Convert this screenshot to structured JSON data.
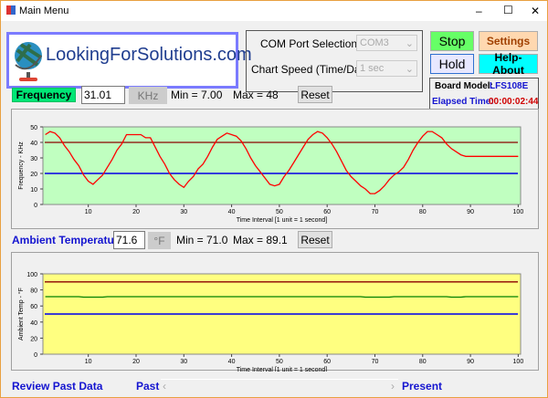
{
  "window": {
    "title": "Main Menu",
    "minimize": "–",
    "maximize": "☐",
    "close": "✕"
  },
  "logo": {
    "text": "LookingForSolutions.com"
  },
  "settings_panel": {
    "com_label": "COM Port Selection",
    "com_value": "COM3",
    "speed_label": "Chart Speed (Time/Data)",
    "speed_value": "1 sec"
  },
  "buttons": {
    "stop": "Stop",
    "settings": "Settings",
    "hold": "Hold",
    "help": "Help-About",
    "reset": "Reset"
  },
  "board": {
    "model_label": "Board Model:",
    "model_value": "LFS108E",
    "elapsed_label": "Elapsed Time:",
    "elapsed_value": "00:00:02:44"
  },
  "frequency": {
    "label": "Frequency",
    "value": "31.01",
    "unit": "KHz",
    "min": "Min = 7.00",
    "max": "Max = 48"
  },
  "temperature": {
    "label": "Ambient Temperature",
    "value": "71.6",
    "unit": "°F",
    "min": "Min = 71.0",
    "max": "Max = 89.1"
  },
  "footer": {
    "review": "Review Past Data",
    "past": "Past",
    "present": "Present"
  },
  "colors": {
    "freq_bg": "#c0ffc0",
    "temp_bg": "#ffff80",
    "series_freq": "#ff0000",
    "series_temp": "#008000",
    "upper": "#8b0000",
    "lower": "#2020e0"
  },
  "chart_data": [
    {
      "type": "line",
      "title": "",
      "xlabel": "Time Interval [1 unit = 1 second]",
      "ylabel": "Frequency - KHz",
      "xlim": [
        1,
        100
      ],
      "ylim": [
        0,
        50
      ],
      "xticks": [
        10,
        20,
        30,
        40,
        50,
        60,
        70,
        80,
        90,
        100
      ],
      "yticks": [
        0,
        10,
        20,
        30,
        40,
        50
      ],
      "series": [
        {
          "name": "Frequency",
          "values": [
            45,
            47,
            46,
            43,
            38,
            34,
            29,
            25,
            19,
            15,
            13,
            16,
            19,
            24,
            29,
            35,
            39,
            45,
            45,
            45,
            45,
            43,
            43,
            37,
            31,
            26,
            20,
            16,
            13,
            11,
            15,
            18,
            23,
            26,
            31,
            37,
            42,
            44,
            46,
            45,
            44,
            41,
            36,
            30,
            25,
            21,
            17,
            13,
            12,
            13,
            18,
            22,
            27,
            32,
            37,
            42,
            45,
            47,
            46,
            43,
            39,
            34,
            28,
            22,
            18,
            15,
            12,
            10,
            7,
            7,
            9,
            12,
            16,
            19,
            21,
            24,
            29,
            35,
            40,
            44,
            47,
            47,
            45,
            43,
            39,
            36,
            34,
            32,
            31,
            31,
            31,
            31,
            31,
            31,
            31,
            31,
            31,
            31,
            31,
            31
          ]
        }
      ],
      "limits": {
        "upper": 40,
        "lower": 20
      }
    },
    {
      "type": "line",
      "title": "",
      "xlabel": "Time Interval [1 unit = 1 second]",
      "ylabel": "Ambient Temp - °F",
      "xlim": [
        1,
        100
      ],
      "ylim": [
        0,
        100
      ],
      "xticks": [
        10,
        20,
        30,
        40,
        50,
        60,
        70,
        80,
        90,
        100
      ],
      "yticks": [
        0,
        20,
        40,
        60,
        80,
        100
      ],
      "series": [
        {
          "name": "Ambient Temperature",
          "values": [
            71.6,
            71.6,
            71.6,
            71.6,
            71.6,
            71.6,
            71.6,
            71.6,
            71.0,
            71.0,
            71.0,
            71.0,
            71.0,
            71.6,
            71.6,
            71.6,
            71.6,
            71.6,
            71.6,
            71.6,
            71.6,
            71.6,
            71.6,
            71.6,
            71.6,
            71.6,
            71.6,
            71.6,
            71.6,
            71.6,
            71.6,
            71.6,
            71.6,
            71.6,
            71.6,
            71.6,
            71.6,
            71.6,
            71.6,
            71.6,
            71.6,
            71.6,
            71.6,
            71.6,
            71.6,
            71.6,
            71.6,
            71.6,
            71.6,
            71.6,
            71.6,
            71.6,
            71.6,
            71.6,
            71.6,
            71.6,
            71.6,
            71.6,
            71.6,
            71.6,
            71.6,
            71.6,
            71.6,
            71.6,
            71.6,
            71.6,
            71.6,
            71.0,
            71.0,
            71.0,
            71.0,
            71.0,
            71.0,
            71.6,
            71.6,
            71.6,
            71.6,
            71.6,
            71.6,
            71.6,
            71.6,
            71.6,
            71.6,
            71.6,
            71.6,
            71.0,
            71.0,
            71.0,
            71.6,
            71.6,
            71.6,
            71.6,
            71.6,
            71.6,
            71.6,
            71.6,
            71.6,
            71.6,
            71.6,
            71.6
          ]
        }
      ],
      "limits": {
        "upper": 90,
        "lower": 50
      }
    }
  ]
}
